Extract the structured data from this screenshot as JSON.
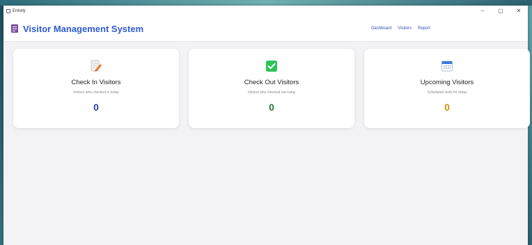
{
  "window": {
    "title": "Entrely",
    "controls": {
      "minimize": "–",
      "maximize": "▢",
      "close": "✕"
    }
  },
  "header": {
    "title": "Visitor Management System",
    "nav": [
      "Dashboard",
      "Visitors",
      "Report"
    ]
  },
  "cards": [
    {
      "title": "Check In Visitors",
      "description": "Visitors who checked in today",
      "count": "0",
      "icon": "edit-document-icon",
      "count_color": "#1f3f9c"
    },
    {
      "title": "Check Out Visitors",
      "description": "Visitors who checked out today",
      "count": "0",
      "icon": "check-box-icon",
      "count_color": "#1e7b35"
    },
    {
      "title": "Upcoming Visitors",
      "description": "Scheduled visits for today",
      "count": "0",
      "icon": "calendar-icon",
      "count_color": "#c9920f"
    }
  ]
}
